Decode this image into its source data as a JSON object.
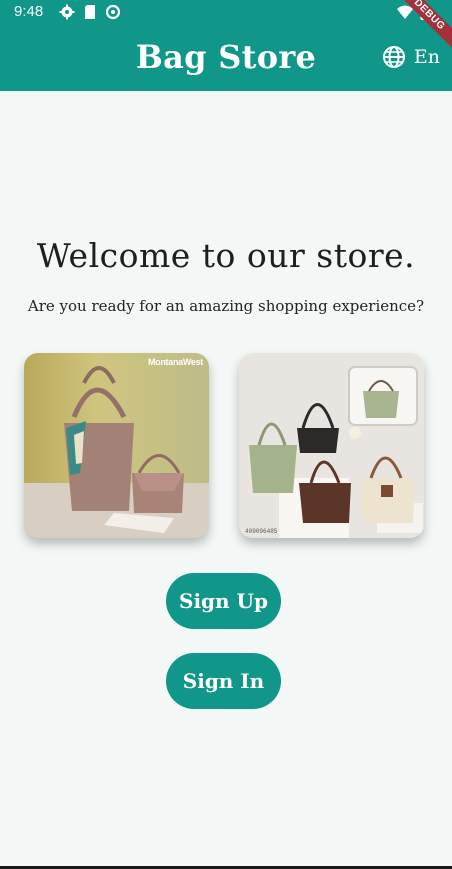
{
  "status_bar": {
    "time": "9:48",
    "left_icons": [
      "gear-icon",
      "sim-card-icon",
      "data-saver-icon"
    ],
    "right_icons": [
      "wifi-icon",
      "battery-icon"
    ]
  },
  "app_bar": {
    "title": "Bag Store",
    "language_icon": "globe-icon",
    "language_label": "En",
    "debug_banner": "DEBUG",
    "color": "#11968a"
  },
  "main": {
    "welcome_title": "Welcome to our store.",
    "welcome_subtitle": "Are you ready for an amazing shopping experience?",
    "images": [
      {
        "name": "product-image-tote-with-scarf",
        "watermark": "MontanaWest"
      },
      {
        "name": "product-image-bag-collection",
        "corner_code": "409096485"
      }
    ],
    "sign_up_label": "Sign Up",
    "sign_in_label": "Sign In",
    "background": "#f3f8f6"
  }
}
